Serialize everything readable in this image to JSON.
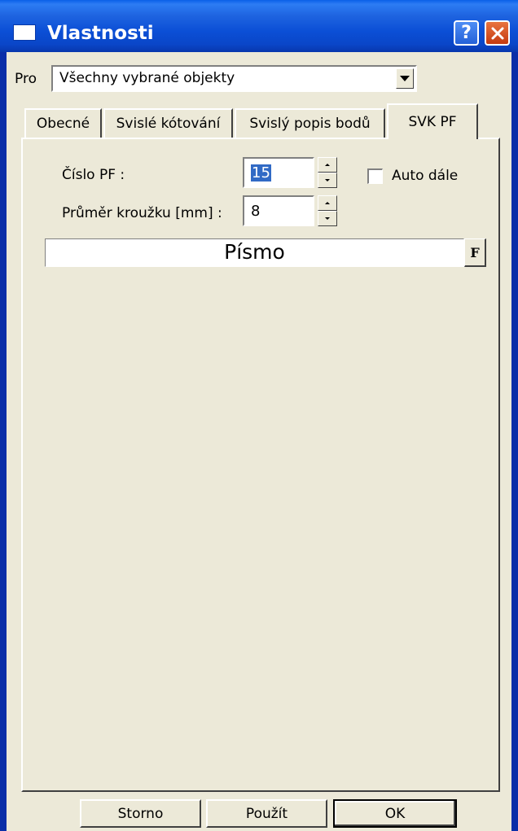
{
  "window": {
    "title": "Vlastnosti",
    "help_label": "?",
    "close_label": "✕"
  },
  "scope": {
    "label": "Pro",
    "selected": "Všechny vybrané objekty"
  },
  "tabs": [
    {
      "label": "Obecné",
      "active": false
    },
    {
      "label": "Svislé kótování",
      "active": false
    },
    {
      "label": "Svislý popis bodů",
      "active": false
    },
    {
      "label": "SVK PF",
      "active": true
    }
  ],
  "form": {
    "cislo_label": "Číslo PF :",
    "cislo_value": "15",
    "auto_label": "Auto dále",
    "auto_checked": false,
    "prumer_label": "Průměr kroužku [mm] :",
    "prumer_value": "8",
    "font_label": "Písmo",
    "font_button": "F"
  },
  "buttons": {
    "cancel": "Storno",
    "apply": "Použít",
    "ok": "OK"
  },
  "colors": {
    "titlebar": "#0a46c8",
    "face": "#ece9d8",
    "selection": "#316ac5",
    "close": "#c53a10"
  }
}
